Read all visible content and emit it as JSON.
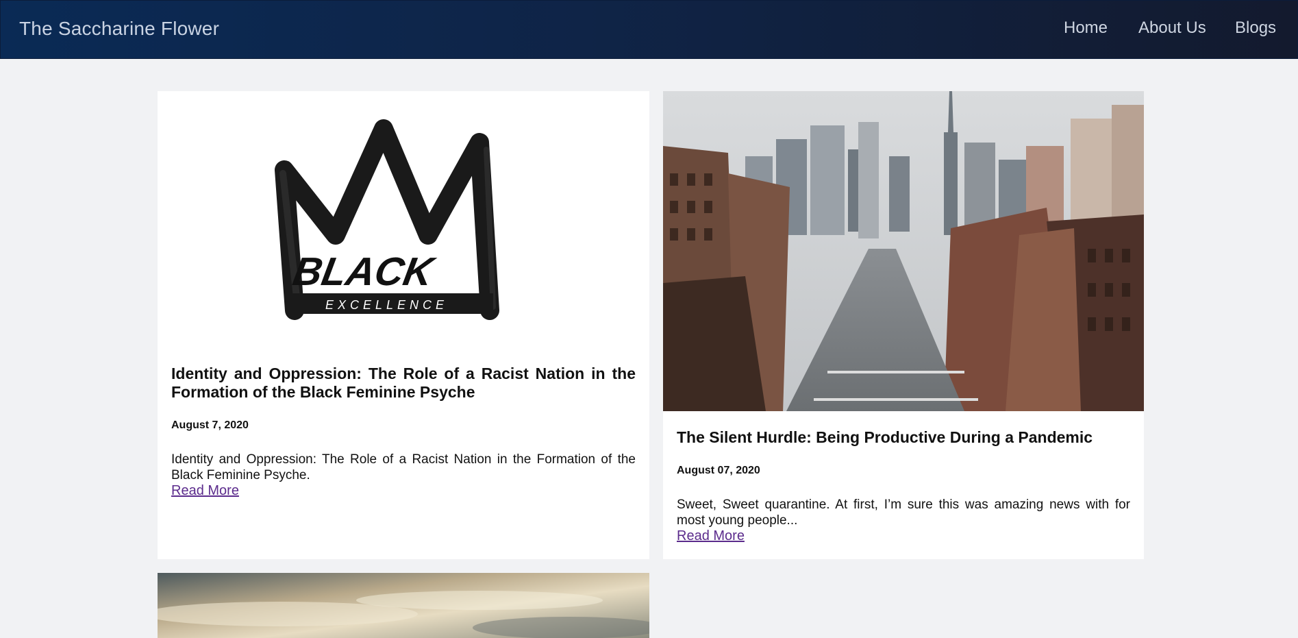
{
  "header": {
    "brand": "The Saccharine Flower",
    "nav": [
      {
        "label": "Home"
      },
      {
        "label": "About Us"
      },
      {
        "label": "Blogs"
      }
    ]
  },
  "posts": [
    {
      "image": "black-excellence-crown-logo",
      "logo_word": "BLACK",
      "logo_subword": "EXCELLENCE",
      "title": "Identity and Oppression: The Role of a Racist Nation in the Formation of the Black Feminine Psyche",
      "date": "August 7, 2020",
      "excerpt": "Identity and Oppression: The Role of a Racist Nation in the Formation of the Black Feminine Psyche.",
      "read_more": "Read More"
    },
    {
      "image": "city-street-aerial-photo",
      "title": "The Silent Hurdle: Being Productive During a Pandemic",
      "date": "August 07, 2020",
      "excerpt": "Sweet, Sweet quarantine. At first, I’m sure this was amazing news with for most young people...",
      "read_more": "Read More"
    },
    {
      "image": "cloudy-sky-photo"
    }
  ],
  "colors": {
    "page_bg": "#f1f2f4",
    "nav_bg": "#0f2447",
    "link": "#5b2b8c"
  }
}
